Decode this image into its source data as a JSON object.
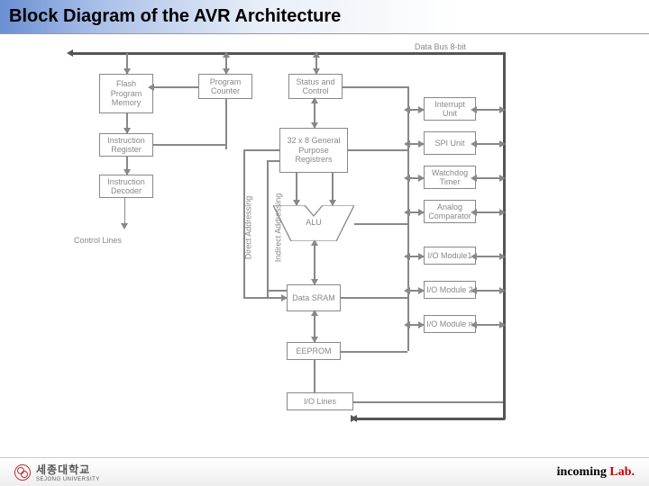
{
  "title": "Block Diagram of the AVR Architecture",
  "bus_label": "Data Bus 8-bit",
  "blocks": {
    "flash": "Flash\nProgram\nMemory",
    "pc": "Program\nCounter",
    "status": "Status\nand Control",
    "ireg": "Instruction\nRegister",
    "gpr": "32 x 8\nGeneral\nPurpose\nRegistrers",
    "idec": "Instruction\nDecoder",
    "alu": "ALU",
    "sram": "Data\nSRAM",
    "eeprom": "EEPROM",
    "iolines": "I/O Lines",
    "interrupt": "Interrupt\nUnit",
    "spi": "SPI\nUnit",
    "wdt": "Watchdog\nTimer",
    "comp": "Analog\nComparator",
    "iom1": "I/O Module1",
    "iom2": "I/O Module 2",
    "iomn": "I/O Module n"
  },
  "labels": {
    "ctrl": "Control Lines",
    "direct": "Direct Addressing",
    "indirect": "Indirect Addressing"
  },
  "footer": {
    "uni": "세종대학교",
    "unisub": "SEJONG UNIVERSITY",
    "lab1": "incoming ",
    "lab2": "Lab."
  }
}
